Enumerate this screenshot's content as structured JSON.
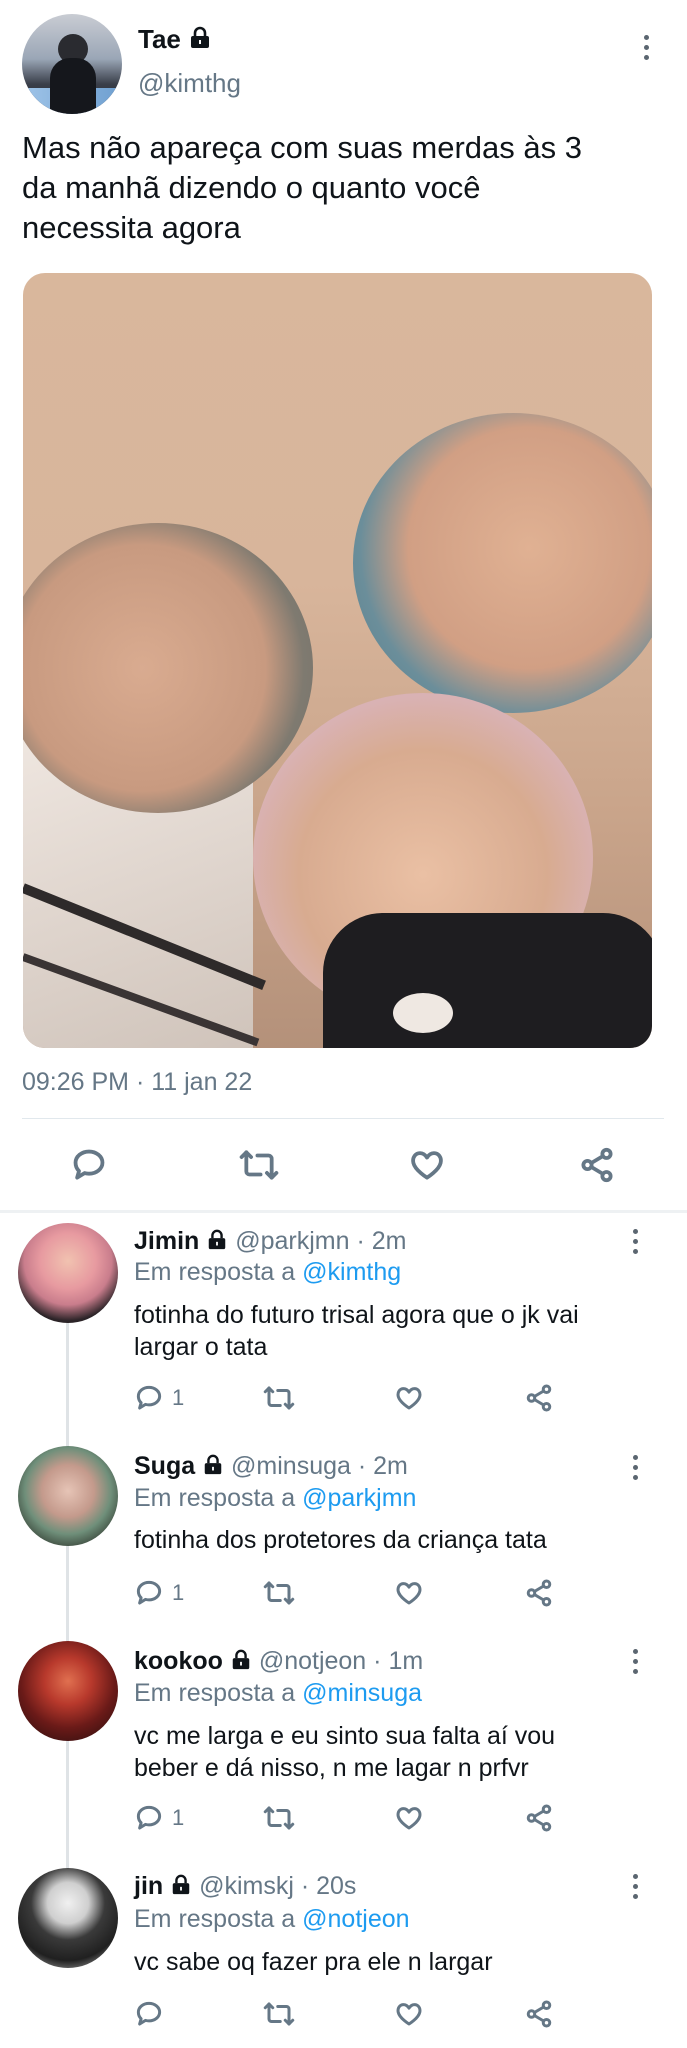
{
  "main_tweet": {
    "display_name": "Tae",
    "handle": "@kimthg",
    "text_lines": [
      "Mas não apareça com suas merdas às 3",
      "da manhã dizendo o quanto você",
      "necessita agora"
    ],
    "timestamp": "09:26 PM · 11 jan 22"
  },
  "reply_prefix": "Em resposta a",
  "replies": [
    {
      "display_name": "Jimin",
      "handle": "@parkjmn",
      "time": "2m",
      "reply_to": "@kimthg",
      "text_lines": [
        "fotinha do futuro trisal agora que o jk vai",
        "largar o tata"
      ],
      "reply_count": "1"
    },
    {
      "display_name": "Suga",
      "handle": "@minsuga",
      "time": "2m",
      "reply_to": "@parkjmn",
      "text_lines": [
        "fotinha dos protetores da criança tata"
      ],
      "reply_count": "1"
    },
    {
      "display_name": "kookoo",
      "handle": "@notjeon",
      "time": "1m",
      "reply_to": "@minsuga",
      "text_lines": [
        "vc me larga e eu sinto sua falta aí vou",
        "beber e dá nisso, n me lagar n prfvr"
      ],
      "reply_count": "1"
    },
    {
      "display_name": "jin",
      "handle": "@kimskj",
      "time": "20s",
      "reply_to": "@notjeon",
      "text_lines": [
        "vc sabe oq fazer pra ele n largar"
      ],
      "reply_count": ""
    }
  ],
  "colors": {
    "link": "#1d9bf0",
    "muted": "#657786",
    "text": "#0f1419"
  }
}
